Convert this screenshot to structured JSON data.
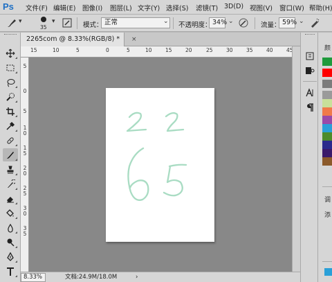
{
  "app": {
    "logo": "Ps"
  },
  "menu": [
    "文件(F)",
    "编辑(E)",
    "图像(I)",
    "图层(L)",
    "文字(Y)",
    "选择(S)",
    "滤镜(T)",
    "3D(D)",
    "视图(V)",
    "窗口(W)",
    "帮助(H)"
  ],
  "options": {
    "brush_size": "35",
    "mode_label": "模式：",
    "mode_value": "正常",
    "opacity_label": "不透明度：",
    "opacity_value": "34%",
    "flow_label": "流量：",
    "flow_value": "59%"
  },
  "document_tab": {
    "title": "2265com @ 8.33%(RGB/8) *",
    "close": "×"
  },
  "ruler_top_labels": [
    "15",
    "10",
    "5",
    "0",
    "5",
    "10",
    "15",
    "20",
    "25",
    "30",
    "35",
    "40",
    "45"
  ],
  "ruler_left_labels": [
    "5",
    "0",
    "5",
    "1 0",
    "1 5",
    "2 0",
    "2 5",
    "3 0",
    "3 5"
  ],
  "status": {
    "zoom": "8.33%",
    "doc_info": "文档:24.9M/18.0M",
    "arrow": "›"
  },
  "right_panel": {
    "panel_labels": [
      "颜",
      "调",
      "添"
    ],
    "swatches": [
      "#1e9a3c",
      "#ff0000",
      "#7c7c7c",
      "#9a9a9a",
      "#c8e09a",
      "#f07a4a",
      "#9a4aa8",
      "#2aa0d8",
      "#4c8c2a",
      "#2a2a8c",
      "#3a1a6a",
      "#8c5a2a"
    ]
  },
  "canvas_text": "2265",
  "colors": {
    "ink": "#a9dcc3",
    "canvas_bg": "#888888",
    "logo": "#1e6fc4"
  }
}
